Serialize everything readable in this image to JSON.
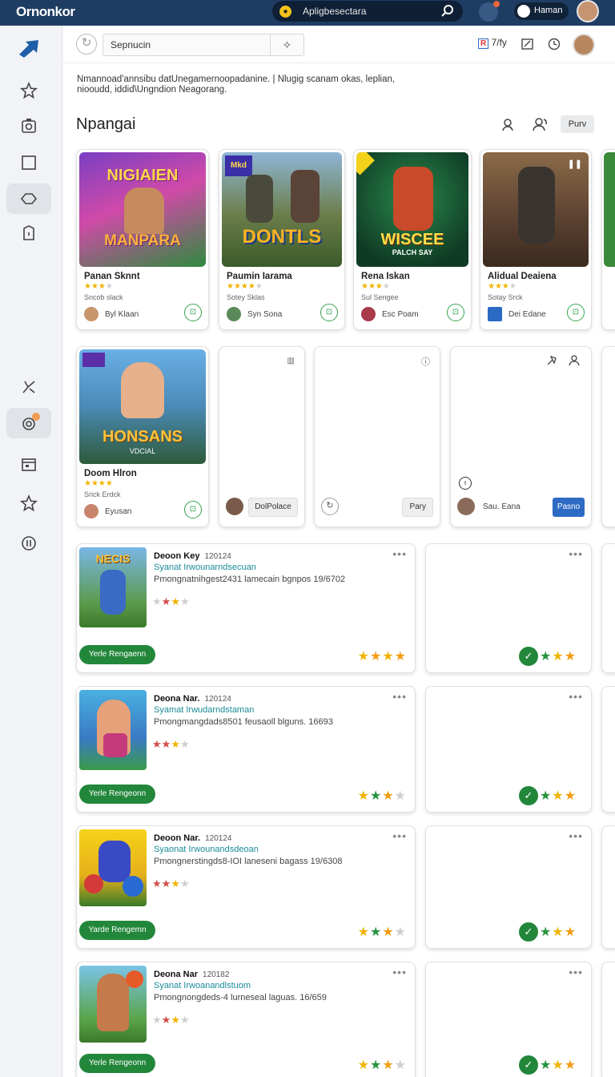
{
  "topbar": {
    "brand": "Ornonkor",
    "search_text": "Apligbesectara",
    "user_name": "Haman"
  },
  "header": {
    "search_value": "Sepnucin",
    "rating_label": "7/fy"
  },
  "description": "Nmannoad'annsibu datUnegamernoopadanine. | Nlugig scanam okas, leplian, niooudd, iddid\\Ungndion Neagorang.",
  "page_title": "Npangai",
  "play_label": "Purv",
  "featured": [
    {
      "title": "Panan Sknnt",
      "sub": "Sncob slack",
      "author": "Byl Klaan",
      "cover_text": "NIGIAIEN",
      "cover_sub": "MANPARA"
    },
    {
      "title": "Paumin Iarama",
      "sub": "Sotey Sklas",
      "author": "Syn Sona",
      "cover_text": "DONTLS",
      "cover_sub": "Mkd"
    },
    {
      "title": "Rena Iskan",
      "sub": "Sul Sengee",
      "author": "Esc Poam",
      "cover_text": "WISCEE",
      "cover_sub": "PALCH SAY"
    },
    {
      "title": "Alidual Deaiena",
      "sub": "Sotay Srck",
      "author": "Dei Edane",
      "cover_text": "",
      "cover_sub": ""
    }
  ],
  "row2": {
    "game": {
      "title": "Doom Hlron",
      "sub": "Srick Erdck",
      "author": "Eyusan",
      "cover_text": "HONSANS",
      "cover_sub": "VDCIAL"
    },
    "placeholders": [
      {
        "author": "DolPolace",
        "button": ""
      },
      {
        "author": "",
        "button": "Pary"
      },
      {
        "author": "Sau. Eana",
        "button": "Pasno"
      }
    ]
  },
  "list": [
    {
      "title": "Deoon Key",
      "date": "120124",
      "subtitle": "Syanat Irwounarndsecuan",
      "meta": "Pmongnatnihgest2431 lamecain bgnpos 19/6702",
      "cta": "Yerle Rengaenn",
      "thumb": "NECIS"
    },
    {
      "title": "Deona Nar.",
      "date": "120124",
      "subtitle": "Syamat Irwudarndstaman",
      "meta": "Pmongmangdads8501 feusaoll blguns. 16693",
      "cta": "Yerle Rengeonn",
      "thumb": ""
    },
    {
      "title": "Deoon Nar.",
      "date": "120124",
      "subtitle": "Syaonat Irwounandsdeoan",
      "meta": "Pmongnerstingds8-IOI laneseni bagass 19/6308",
      "cta": "Yarde Rengemn",
      "thumb": ""
    },
    {
      "title": "Deona Nar",
      "date": "120182",
      "subtitle": "Syanat Irwoanandlstuom",
      "meta": "Pmongnongdeds-4 lurneseal laguas. 16/659",
      "cta": "Yerle Rengeonn",
      "thumb": ""
    }
  ],
  "colors": {
    "topbar": "#1f3d63",
    "accent_green": "#22873b",
    "accent_blue": "#2d6bc4",
    "star_yellow": "#f0b400"
  }
}
